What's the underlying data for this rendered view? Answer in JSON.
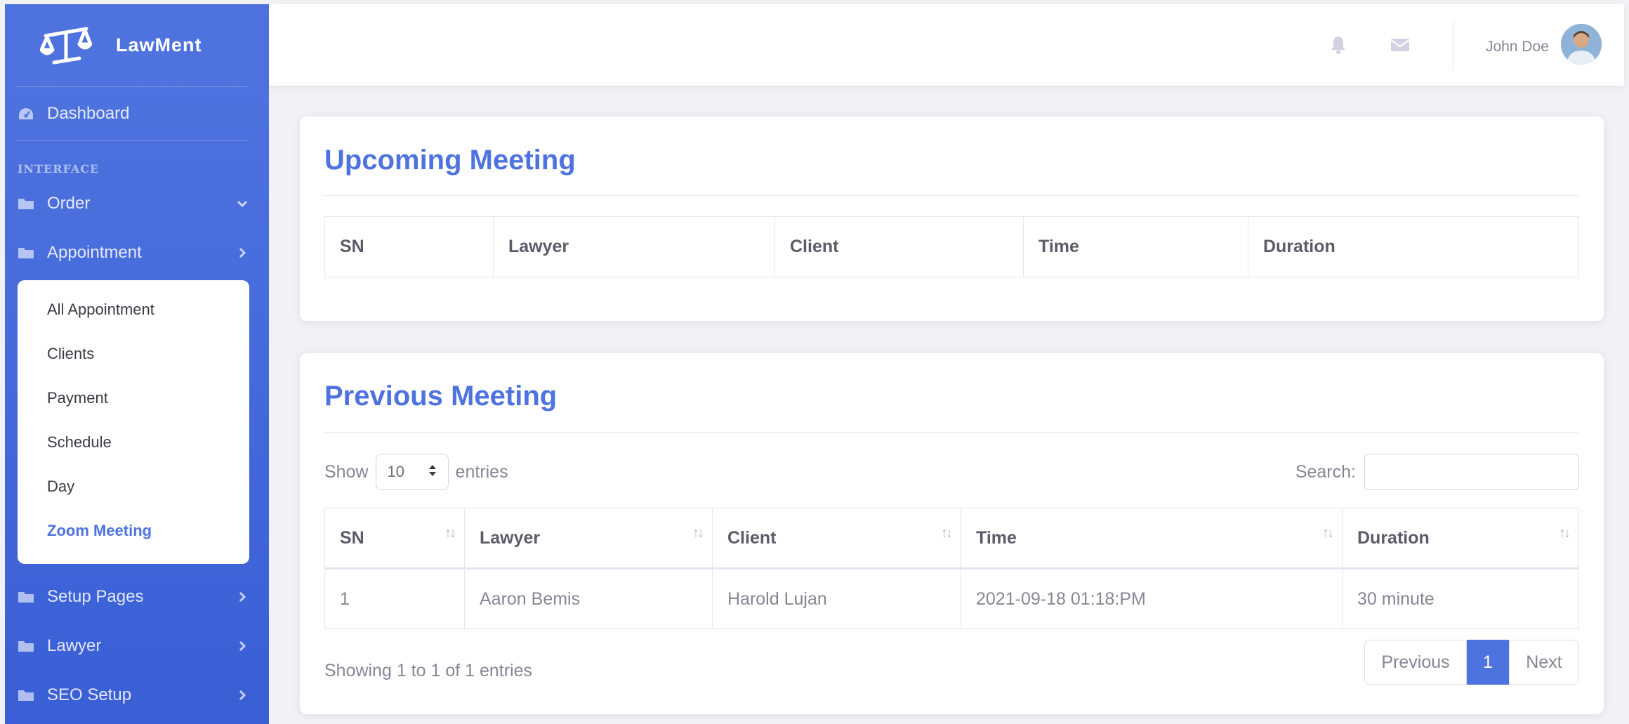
{
  "brand": {
    "name": "LawMent",
    "icon": "scales-of-justice-icon"
  },
  "sidebar": {
    "dashboard_label": "Dashboard",
    "section_heading": "INTERFACE",
    "items": [
      {
        "label": "Order",
        "icon": "folder-icon",
        "caret": "chevron-down-icon"
      },
      {
        "label": "Appointment",
        "icon": "folder-icon",
        "caret": "chevron-right-icon"
      },
      {
        "label": "Setup Pages",
        "icon": "folder-icon",
        "caret": "chevron-right-icon"
      },
      {
        "label": "Lawyer",
        "icon": "folder-icon",
        "caret": "chevron-right-icon"
      },
      {
        "label": "SEO Setup",
        "icon": "folder-icon",
        "caret": "chevron-right-icon"
      }
    ],
    "submenu": [
      {
        "label": "All Appointment"
      },
      {
        "label": "Clients"
      },
      {
        "label": "Payment"
      },
      {
        "label": "Schedule"
      },
      {
        "label": "Day"
      },
      {
        "label": "Zoom Meeting",
        "active": true
      }
    ]
  },
  "topbar": {
    "user_name": "John Doe",
    "icons": [
      "bell-icon",
      "envelope-icon"
    ]
  },
  "upcoming": {
    "title": "Upcoming Meeting",
    "columns": [
      "SN",
      "Lawyer",
      "Client",
      "Time",
      "Duration"
    ]
  },
  "previous": {
    "title": "Previous Meeting",
    "show_label": "Show",
    "entries_label": "entries",
    "page_size": "10",
    "search_label": "Search:",
    "search_value": "",
    "columns": [
      "SN",
      "Lawyer",
      "Client",
      "Time",
      "Duration"
    ],
    "rows": [
      {
        "sn": "1",
        "lawyer": "Aaron Bemis",
        "client": "Harold Lujan",
        "time": "2021-09-18 01:18:PM",
        "duration": "30 minute"
      }
    ],
    "info": "Showing 1 to 1 of 1 entries",
    "pager": {
      "prev": "Previous",
      "current": "1",
      "next": "Next"
    }
  },
  "colors": {
    "primary": "#4e73df",
    "sidebar_end": "#3a5fd6"
  }
}
